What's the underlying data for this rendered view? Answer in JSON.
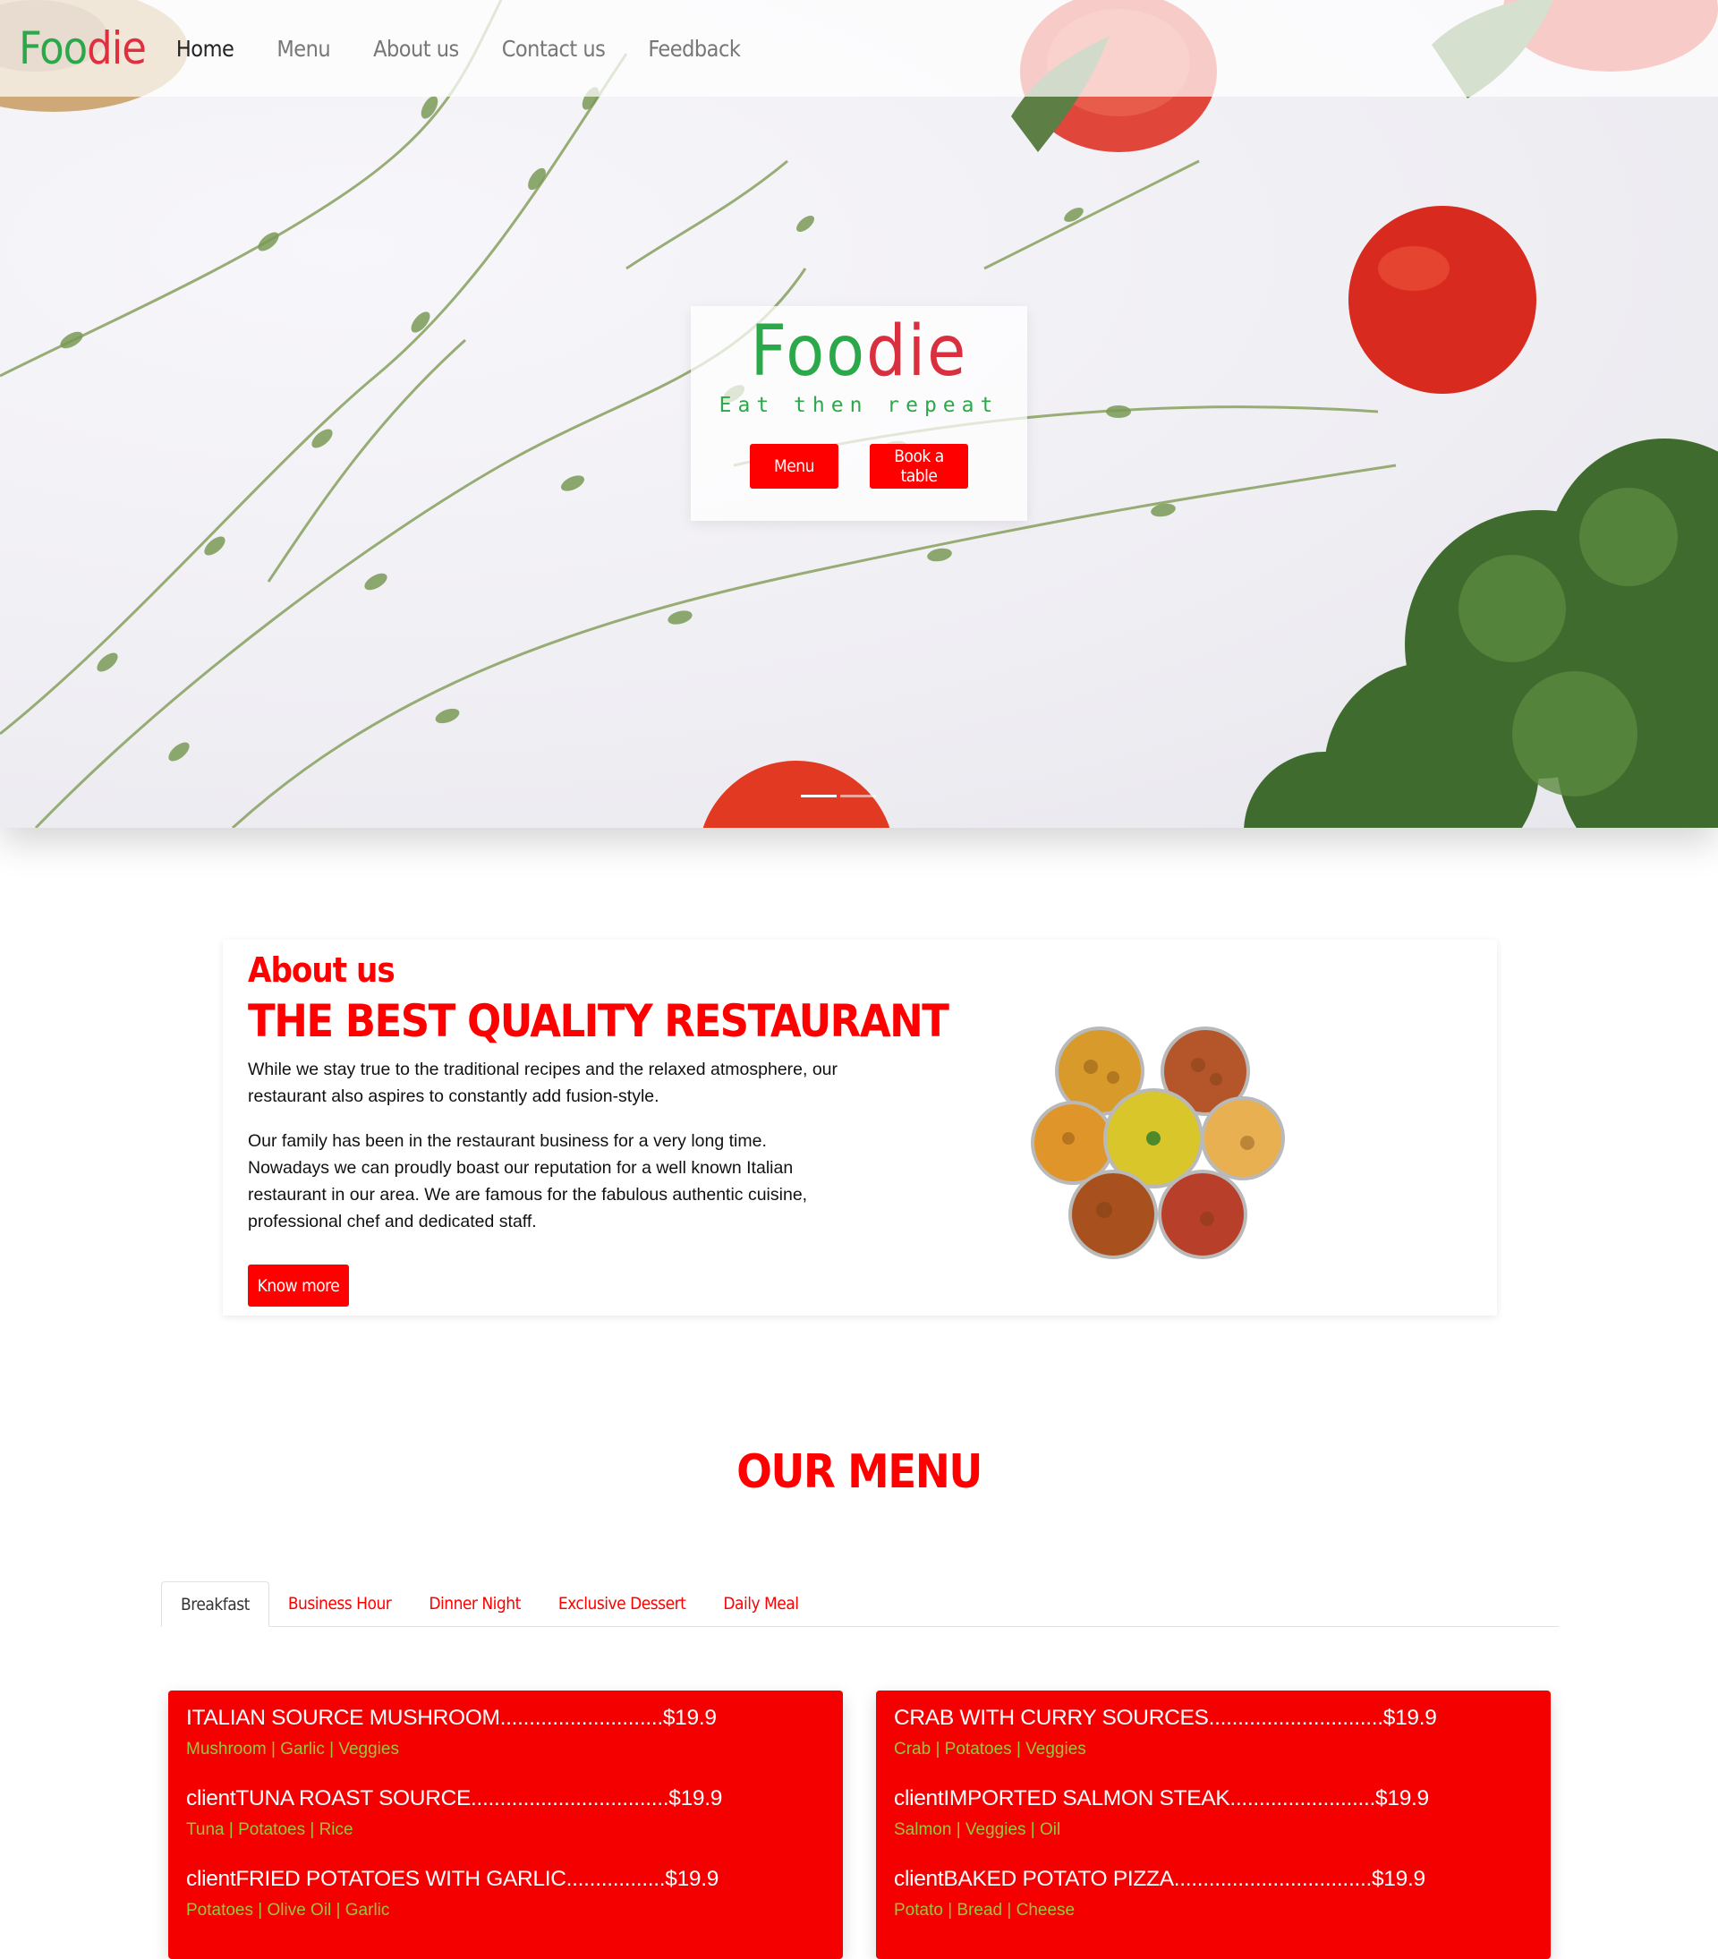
{
  "navbar": {
    "brand_part1": "Foo",
    "brand_part2": "die",
    "links": [
      "Home",
      "Menu",
      "About us",
      "Contact us",
      "Feedback"
    ]
  },
  "hero": {
    "title_part1": "Foo",
    "title_part2": "die",
    "tagline": "Eat then repeat",
    "menu_button": "Menu",
    "book_button": "Book a table"
  },
  "about": {
    "heading": "About us",
    "title": "THE BEST QUALITY RESTAURANT",
    "paragraph1": "While we stay true to the traditional recipes and the relaxed atmosphere, our restaurant also aspires to constantly add fusion-style.",
    "paragraph2": "Our family has been in the restaurant business for a very long time. Nowadays we can proudly boast our reputation for a well known Italian restaurant in our area. We are famous for the fabulous authentic cuisine, professional chef and dedicated staff.",
    "button": "Know more"
  },
  "menu": {
    "heading": "OUR MENU",
    "tabs": [
      "Breakfast",
      "Business Hour",
      "Dinner Night",
      "Exclusive Dessert",
      "Daily Meal"
    ],
    "active_tab": "Breakfast",
    "cards": [
      {
        "items": [
          {
            "name": "ITALIAN SOURCE MUSHROOM............................$19.9",
            "ingredients": "Mushroom | Garlic | Veggies"
          },
          {
            "name": "clientTUNA ROAST SOURCE..................................$19.9",
            "ingredients": "Tuna | Potatoes | Rice"
          },
          {
            "name": "clientFRIED POTATOES WITH GARLIC.................$19.9",
            "ingredients": "Potatoes | Olive Oil | Garlic"
          }
        ]
      },
      {
        "items": [
          {
            "name": "CRAB WITH CURRY SOURCES..............................$19.9",
            "ingredients": "Crab | Potatoes | Veggies"
          },
          {
            "name": "clientIMPORTED SALMON STEAK.........................$19.9",
            "ingredients": "Salmon | Veggies | Oil"
          },
          {
            "name": "clientBAKED POTATO PIZZA..................................$19.9",
            "ingredients": "Potato | Bread | Cheese"
          }
        ]
      }
    ]
  },
  "colors": {
    "accent_red": "#ff0000",
    "card_red": "#f40000",
    "brand_green": "#2aa84a",
    "ingredient_green": "#9bc53d"
  }
}
